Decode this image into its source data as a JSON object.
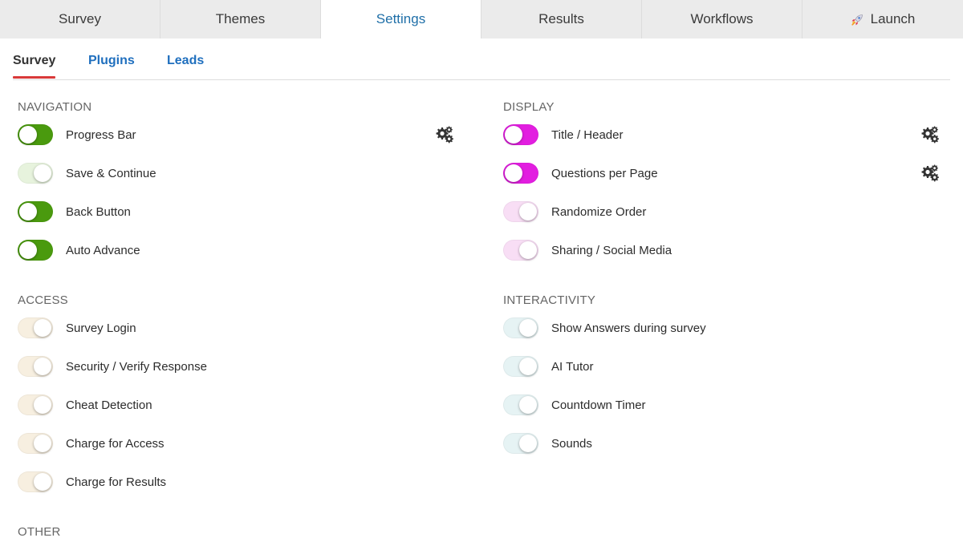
{
  "colors": {
    "nav_on": "#4a9a0e",
    "nav_off": "#e7f3dd",
    "display_on": "#e21ee0",
    "display_off": "#f8def5",
    "access_off": "#f7efe0",
    "interactivity_off": "#e6f3f4",
    "active_tab_text": "#1f6fa8",
    "subtab_link": "#1f6fbe",
    "subtab_underline": "#d93a3a"
  },
  "top_tabs": [
    {
      "label": "Survey"
    },
    {
      "label": "Themes"
    },
    {
      "label": "Settings",
      "active": true
    },
    {
      "label": "Results"
    },
    {
      "label": "Workflows"
    },
    {
      "label": "Launch",
      "icon": "rocket-icon"
    }
  ],
  "sub_tabs": [
    {
      "label": "Survey",
      "active": true
    },
    {
      "label": "Plugins"
    },
    {
      "label": "Leads"
    }
  ],
  "sections": {
    "navigation": {
      "heading": "NAVIGATION",
      "items": [
        {
          "label": "Progress Bar",
          "enabled": true,
          "has_settings": true
        },
        {
          "label": "Save & Continue",
          "enabled": false
        },
        {
          "label": "Back Button",
          "enabled": true
        },
        {
          "label": "Auto Advance",
          "enabled": true
        }
      ]
    },
    "display": {
      "heading": "DISPLAY",
      "items": [
        {
          "label": "Title / Header",
          "enabled": true,
          "has_settings": true
        },
        {
          "label": "Questions per Page",
          "enabled": true,
          "has_settings": true
        },
        {
          "label": "Randomize Order",
          "enabled": false
        },
        {
          "label": "Sharing / Social Media",
          "enabled": false
        }
      ]
    },
    "access": {
      "heading": "ACCESS",
      "items": [
        {
          "label": "Survey Login",
          "enabled": false
        },
        {
          "label": "Security / Verify Response",
          "enabled": false
        },
        {
          "label": "Cheat Detection",
          "enabled": false
        },
        {
          "label": "Charge for Access",
          "enabled": false
        },
        {
          "label": "Charge for Results",
          "enabled": false
        }
      ]
    },
    "interactivity": {
      "heading": "INTERACTIVITY",
      "items": [
        {
          "label": "Show Answers during survey",
          "enabled": false
        },
        {
          "label": "AI Tutor",
          "enabled": false
        },
        {
          "label": "Countdown Timer",
          "enabled": false
        },
        {
          "label": "Sounds",
          "enabled": false
        }
      ]
    },
    "other": {
      "heading": "OTHER"
    }
  }
}
